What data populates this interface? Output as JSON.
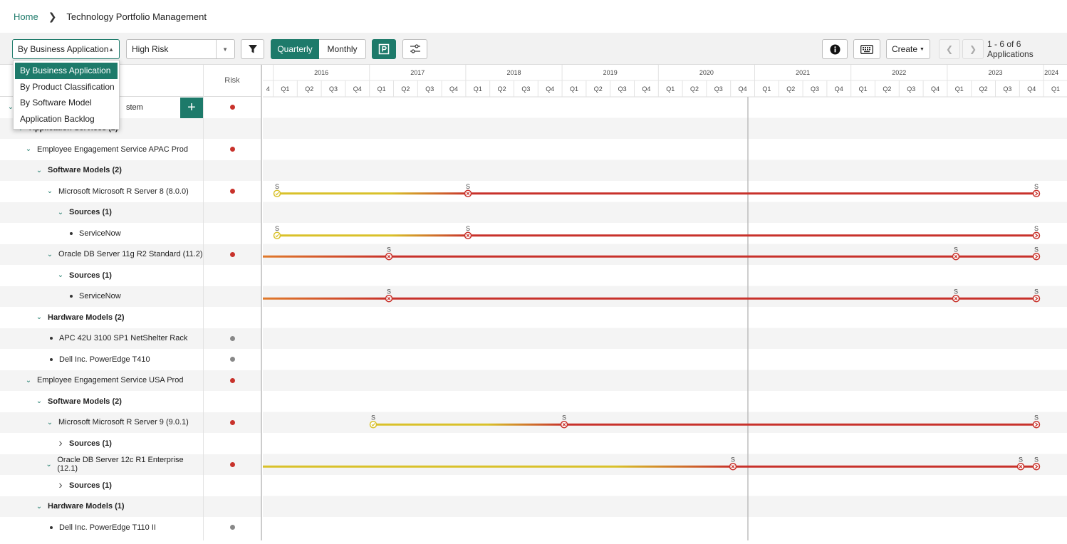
{
  "breadcrumb": {
    "home": "Home",
    "current": "Technology Portfolio Management"
  },
  "toolbar": {
    "group_by": "By Business Application",
    "risk_filter": "High Risk",
    "quarterly": "Quarterly",
    "monthly": "Monthly",
    "create": "Create",
    "count": "1 - 6 of 6 Applications"
  },
  "dropdown": {
    "options": [
      "By Business Application",
      "By Product Classification",
      "By Software Model",
      "Application Backlog"
    ]
  },
  "table": {
    "risk_header": "Risk",
    "first_row_partial": "stem",
    "second_row_partial": "Application Services (2)",
    "rows": [
      {
        "label": "Employee Engagement Service APAC Prod"
      },
      {
        "label": "Software Models (2)"
      },
      {
        "label": "Microsoft Microsoft R Server 8 (8.0.0)"
      },
      {
        "label": "Sources (1)"
      },
      {
        "label": "ServiceNow"
      },
      {
        "label": "Oracle DB Server 11g R2 Standard (11.2)"
      },
      {
        "label": "Sources (1)"
      },
      {
        "label": "ServiceNow"
      },
      {
        "label": "Hardware Models (2)"
      },
      {
        "label": "APC 42U 3100 SP1 NetShelter Rack"
      },
      {
        "label": "Dell Inc. PowerEdge T410"
      },
      {
        "label": "Employee Engagement Service USA Prod"
      },
      {
        "label": "Software Models (2)"
      },
      {
        "label": "Microsoft Microsoft R Server 9 (9.0.1)"
      },
      {
        "label": "Sources (1)"
      },
      {
        "label": "Oracle DB Server 12c R1 Enterprise (12.1)"
      },
      {
        "label": "Sources (1)"
      },
      {
        "label": "Hardware Models (1)"
      },
      {
        "label": "Dell Inc. PowerEdge T110 II"
      }
    ]
  },
  "timeline": {
    "years": [
      "2016",
      "2017",
      "2018",
      "2019",
      "2020",
      "2021",
      "2022",
      "2023",
      "2024"
    ],
    "quarters": [
      "4",
      "Q1",
      "Q2",
      "Q3",
      "Q4",
      "Q1",
      "Q2",
      "Q3",
      "Q4",
      "Q1",
      "Q2",
      "Q3",
      "Q4",
      "Q1",
      "Q2",
      "Q3",
      "Q4",
      "Q1",
      "Q2",
      "Q3",
      "Q4",
      "Q1",
      "Q2",
      "Q3",
      "Q4",
      "Q1",
      "Q2",
      "Q3",
      "Q4",
      "Q1",
      "Q2",
      "Q3",
      "Q4",
      "Q1"
    ],
    "marker_label": "S",
    "colors": {
      "yellow": "#d9c12a",
      "orange": "#e07a2b",
      "red": "#c8322b",
      "teal": "#1d7a6a",
      "grey_dot": "#888888"
    }
  }
}
